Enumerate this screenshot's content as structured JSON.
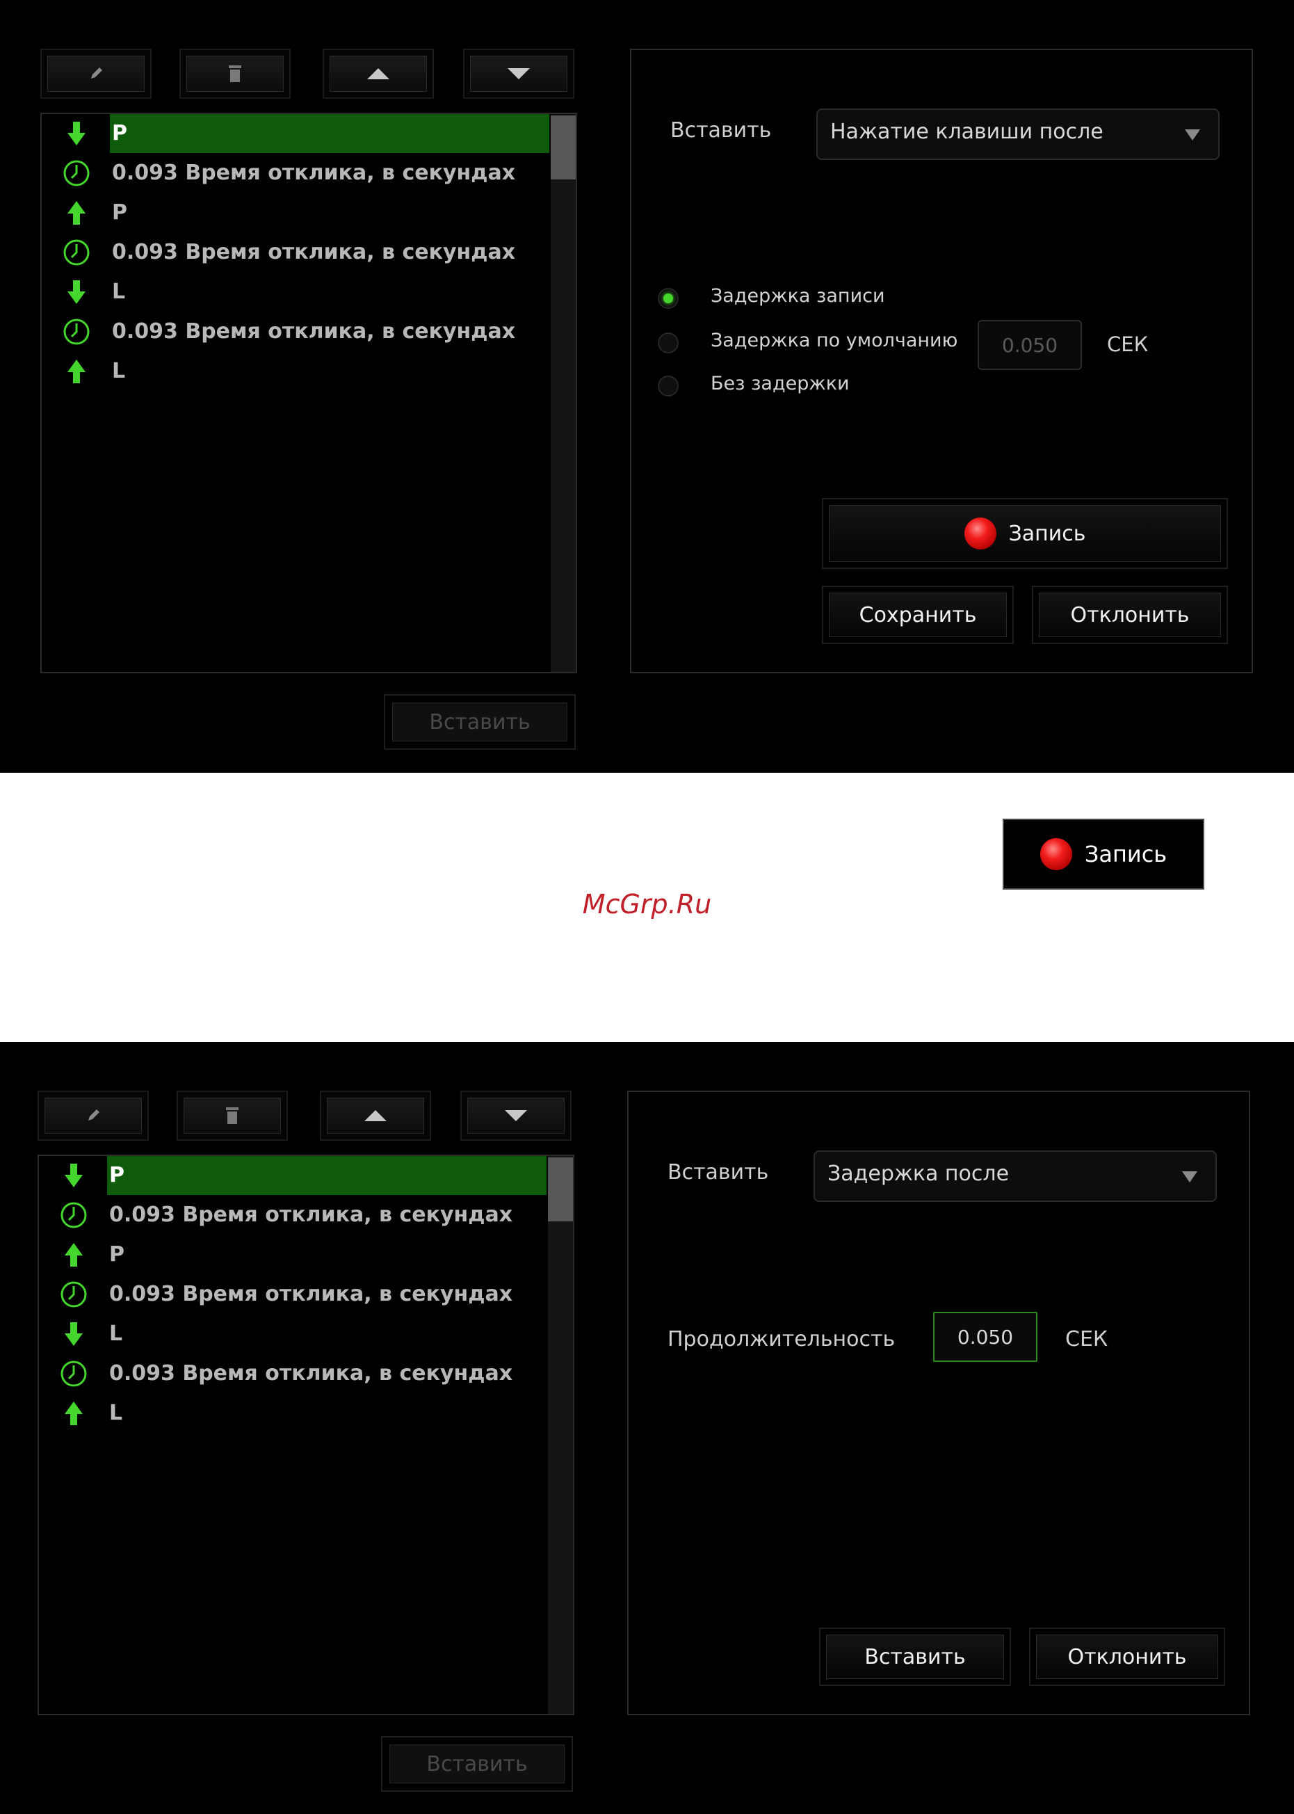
{
  "colors": {
    "accent_green": "#44d62c",
    "selection_green": "#0f5b0c",
    "record_red": "#f21c1c",
    "watermark_red": "#c0202a"
  },
  "toolbar": {
    "icons": [
      "pencil-icon",
      "trash-icon",
      "arrow-up-icon",
      "arrow-down-icon"
    ]
  },
  "macro_rows": [
    {
      "icon": "key-down-icon",
      "text": "P",
      "selected": true
    },
    {
      "icon": "clock-icon",
      "text": "0.093 Время отклика, в секундах"
    },
    {
      "icon": "key-up-icon",
      "text": "P"
    },
    {
      "icon": "clock-icon",
      "text": "0.093 Время отклика, в секундах"
    },
    {
      "icon": "key-down-icon",
      "text": "L"
    },
    {
      "icon": "clock-icon",
      "text": "0.093 Время отклика, в секундах"
    },
    {
      "icon": "key-up-icon",
      "text": "L"
    }
  ],
  "panel1": {
    "insert_label": "Вставить",
    "insert_dropdown_value": "Нажатие клавиши после",
    "radio_record_delay": "Задержка записи",
    "radio_default_delay": "Задержка по умолчанию",
    "radio_no_delay": "Без задержки",
    "selected_radio": "record_delay",
    "default_delay_value": "0.050",
    "unit": "СЕК",
    "record_button": "Запись",
    "save_button": "Сохранить",
    "cancel_button": "Отклонить",
    "bottom_insert_button": "Вставить"
  },
  "callout": {
    "record_button": "Запись"
  },
  "watermark": "McGrp.Ru",
  "panel2": {
    "insert_label": "Вставить",
    "insert_dropdown_value": "Задержка после",
    "duration_label": "Продолжительность",
    "duration_value": "0.050",
    "unit": "СЕК",
    "insert_button": "Вставить",
    "cancel_button": "Отклонить",
    "bottom_insert_button": "Вставить"
  }
}
